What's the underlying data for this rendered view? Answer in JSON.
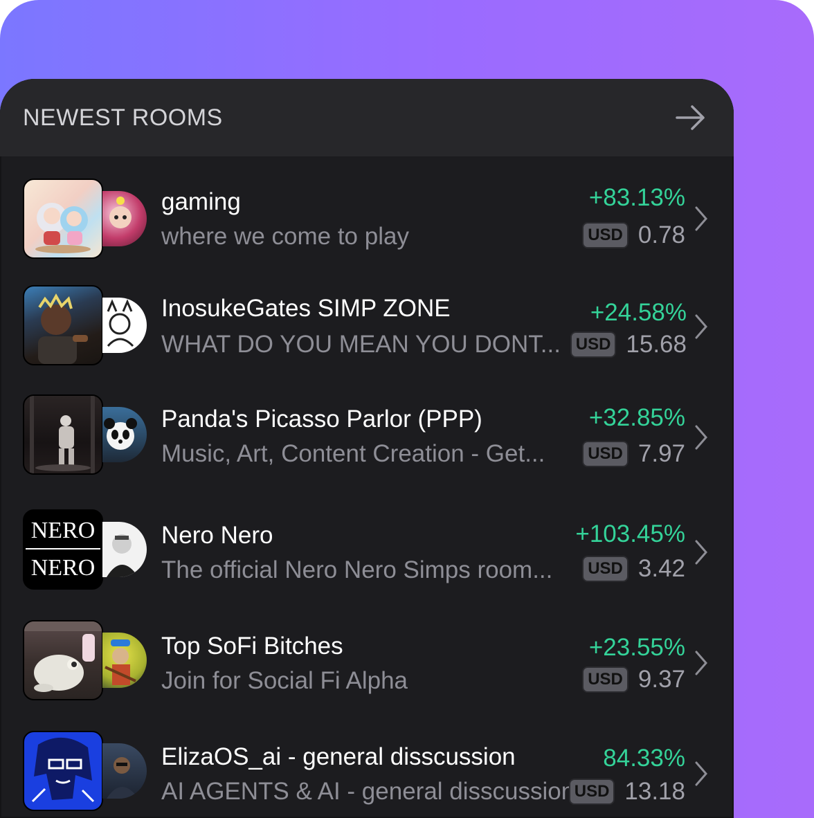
{
  "panel": {
    "title": "NEWEST ROOMS",
    "arrow_icon": "arrow-right-icon"
  },
  "colors": {
    "positive": "#34d399",
    "accent_gradient_start": "#7b77ff",
    "accent_gradient_end": "#a86bfb"
  },
  "rooms": [
    {
      "name": "gaming",
      "description": "where we come to play",
      "change": "+83.13%",
      "currency": "USD",
      "price": "0.78"
    },
    {
      "name": "InosukeGates SIMP ZONE",
      "description": "WHAT DO YOU MEAN YOU DONT...",
      "change": "+24.58%",
      "currency": "USD",
      "price": "15.68"
    },
    {
      "name": "Panda's Picasso Parlor (PPP)",
      "description": "Music, Art, Content Creation - Get...",
      "change": "+32.85%",
      "currency": "USD",
      "price": "7.97"
    },
    {
      "name": "Nero Nero",
      "description": "The official Nero Nero Simps room...",
      "change": "+103.45%",
      "currency": "USD",
      "price": "3.42",
      "logo_text": "NERO"
    },
    {
      "name": "Top SoFi Bitches",
      "description": "Join for Social Fi Alpha",
      "change": "+23.55%",
      "currency": "USD",
      "price": "9.37"
    },
    {
      "name": "ElizaOS_ai - general disscussion",
      "description": "AI AGENTS & AI - general disscussion",
      "change": "84.33%",
      "currency": "USD",
      "price": "13.18"
    }
  ]
}
